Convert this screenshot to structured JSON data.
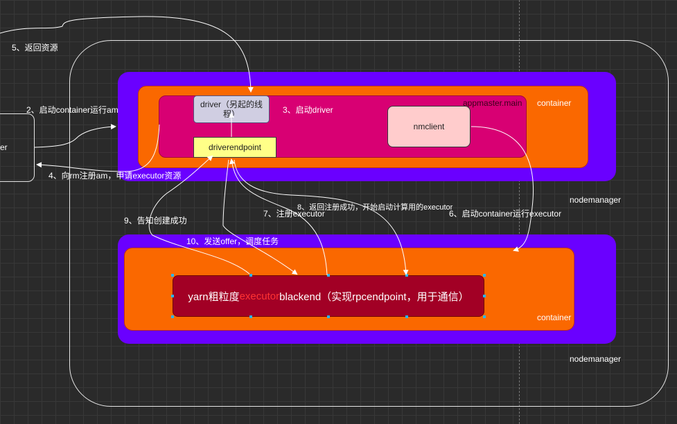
{
  "nodes": {
    "client_label": "er",
    "driver": "driver（另起的线程）",
    "driver_endpoint": "driverendpoint",
    "appmaster": "appmaster.main",
    "nmclient": "nmclient",
    "container_top": "container",
    "container_bottom": "container",
    "nodemanager_top": "nodemanager",
    "nodemanager_bottom": "nodemanager",
    "executor_backend": {
      "prefix": "yarn粗粒度",
      "highlight": "executor",
      "suffix": "blackend（实现rpcendpoint，用于通信）"
    }
  },
  "edges": {
    "step2": "2、启动container运行am",
    "step3": "3、启动driver",
    "step4": "4、向rm注册am，申请executor资源",
    "step5": "5、返回资源",
    "step6": "6、启动container运行executor",
    "step7": "7、注册executor",
    "step8": "8、返回注册成功，开始启动计算用的executor",
    "step9": "9、告知创建成功",
    "step10": "10、发送offer，调度任务"
  },
  "colors": {
    "background": "#2a2a2a",
    "nodemanager_fill": "#6a00ff",
    "container_fill": "#fa6800",
    "appmaster_fill": "#d80073",
    "driver_fill": "#d0cee2",
    "endpoint_fill": "#ffff88",
    "nmclient_fill": "#ffcccc",
    "executor_fill": "#a20025",
    "executor_highlight": "#ff3333"
  }
}
